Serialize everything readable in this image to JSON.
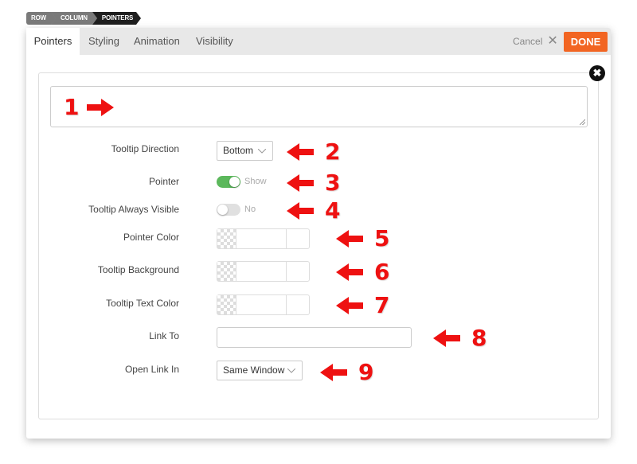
{
  "breadcrumb": [
    "ROW",
    "COLUMN",
    "POINTERS"
  ],
  "tabs": [
    {
      "label": "Pointers",
      "active": true
    },
    {
      "label": "Styling",
      "active": false
    },
    {
      "label": "Animation",
      "active": false
    },
    {
      "label": "Visibility",
      "active": false
    }
  ],
  "header": {
    "cancel_label": "Cancel",
    "cancel_icon": "close-icon",
    "done_label": "DONE",
    "accent_color": "#f26522"
  },
  "close_icon": "close-circle-icon",
  "content": {
    "textarea_value": ""
  },
  "fields": {
    "tooltip_direction": {
      "label": "Tooltip Direction",
      "value": "Bottom"
    },
    "pointer": {
      "label": "Pointer",
      "state": true,
      "state_label": "Show"
    },
    "tooltip_always_visible": {
      "label": "Tooltip Always Visible",
      "state": false,
      "state_label": "No"
    },
    "pointer_color": {
      "label": "Pointer Color",
      "value": ""
    },
    "tooltip_background": {
      "label": "Tooltip Background",
      "value": ""
    },
    "tooltip_text_color": {
      "label": "Tooltip Text Color",
      "value": ""
    },
    "link_to": {
      "label": "Link To",
      "value": ""
    },
    "open_link_in": {
      "label": "Open Link In",
      "value": "Same Window"
    }
  },
  "annotations": {
    "color": "#ee1111",
    "items": [
      "1",
      "2",
      "3",
      "4",
      "5",
      "6",
      "7",
      "8",
      "9"
    ]
  }
}
